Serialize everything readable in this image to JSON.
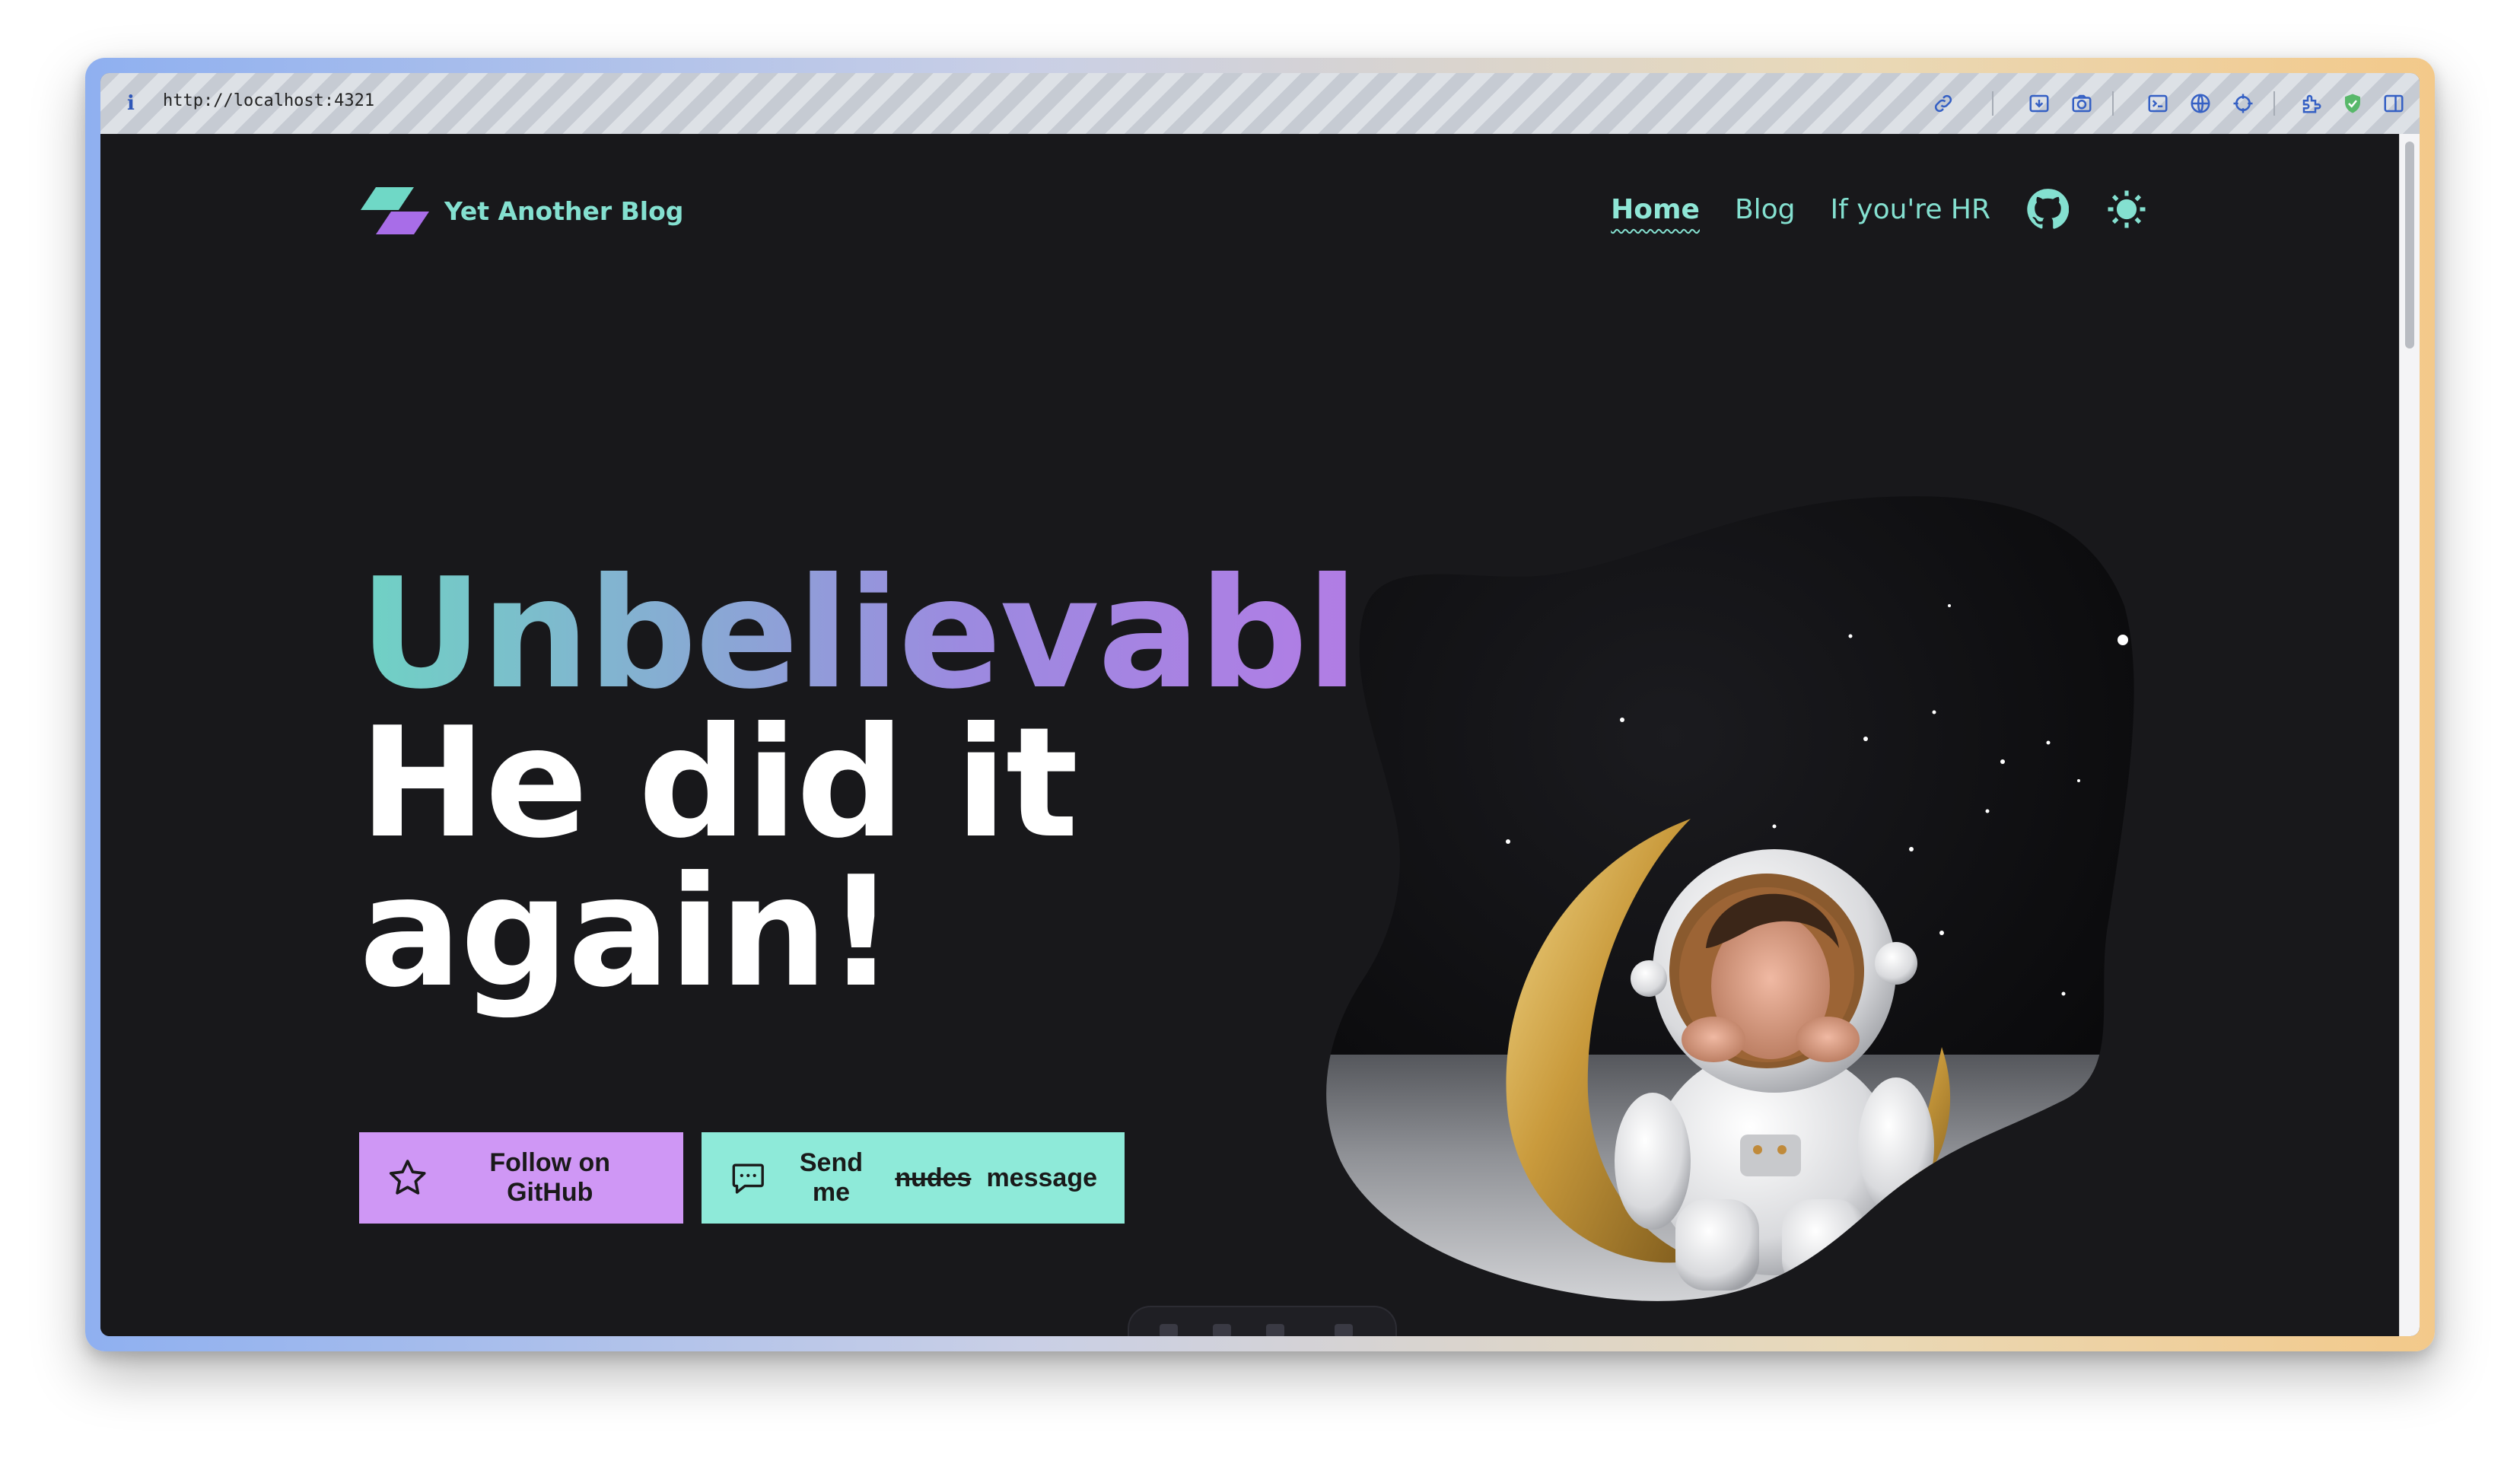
{
  "browser": {
    "url": "http://localhost:4321",
    "info_icon": "i",
    "icons": [
      "link-icon",
      "download-icon",
      "camera-icon",
      "terminal-icon",
      "globe-icon",
      "target-icon",
      "extension-icon",
      "shield-icon",
      "sidebar-icon"
    ]
  },
  "site": {
    "brand_name": "Yet Another Blog",
    "nav": [
      {
        "label": "Home",
        "active": true
      },
      {
        "label": "Blog",
        "active": false
      },
      {
        "label": "If you're HR",
        "active": false
      }
    ],
    "nav_icons": [
      "github-icon",
      "sun-icon"
    ]
  },
  "hero": {
    "line1": "Unbelievable",
    "line2": "He did it",
    "line3": "again!",
    "buttons": {
      "github_label": "Follow on GitHub",
      "message_prefix": "Send me",
      "message_struck": "nudes",
      "message_suffix": "message"
    },
    "image_alt": "astronaut figurine sitting on golden crescent moon"
  },
  "colors": {
    "background": "#18181b",
    "accent_teal": "#84e0d0",
    "accent_purple": "#cf97f5",
    "button_teal": "#8eead9"
  }
}
